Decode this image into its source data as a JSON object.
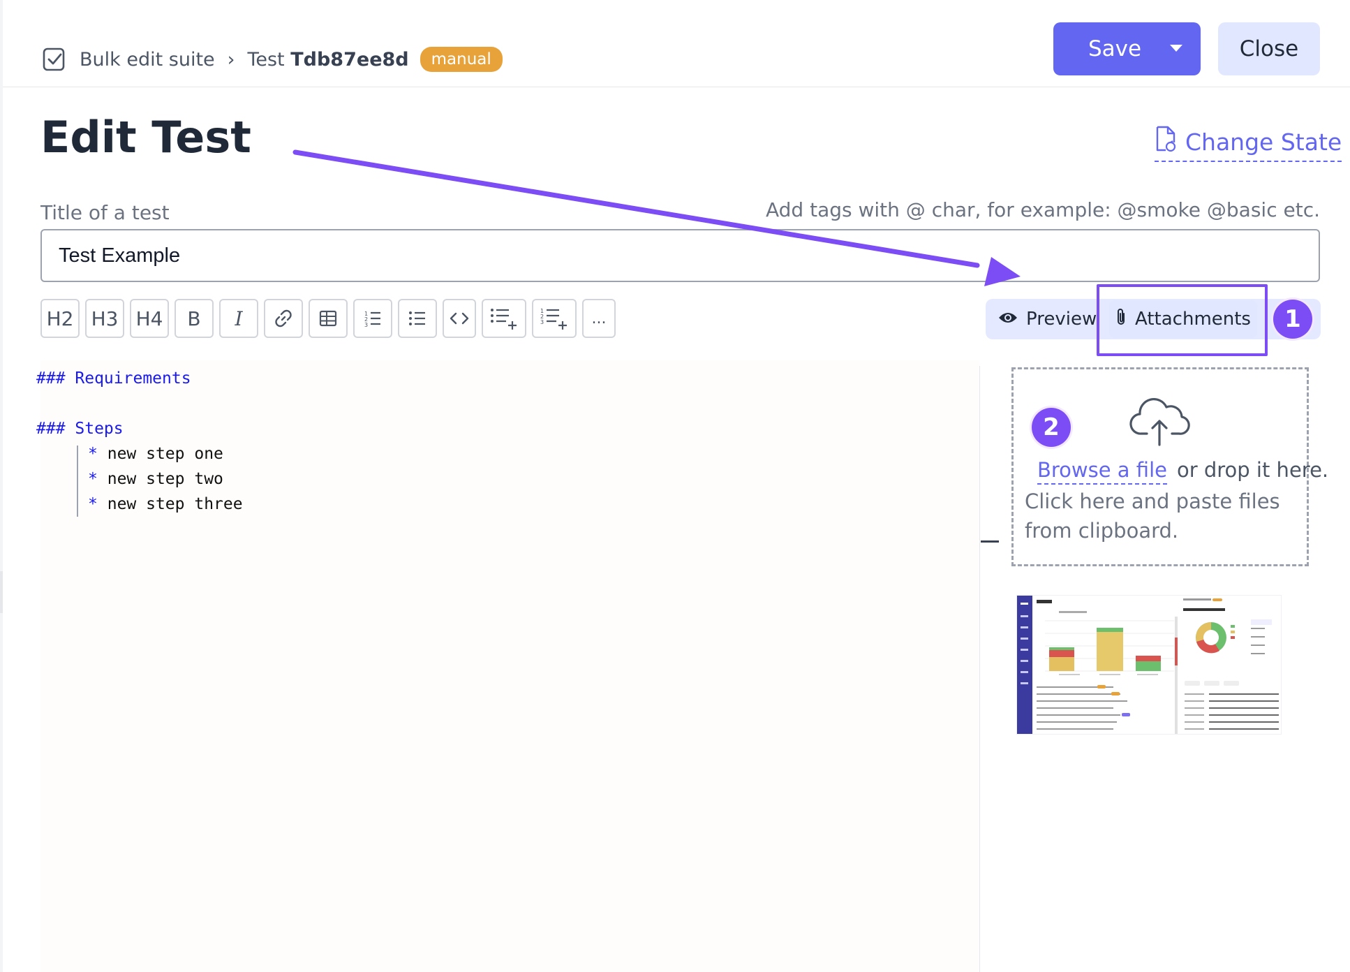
{
  "breadcrumb": {
    "suite": "Bulk edit suite",
    "separator": "›",
    "test_prefix": "Test",
    "test_id": "Tdb87ee8d",
    "badge": "manual"
  },
  "header": {
    "save_label": "Save",
    "close_label": "Close"
  },
  "page": {
    "title": "Edit Test",
    "change_state": "Change State"
  },
  "form": {
    "title_label": "Title of a test",
    "tags_hint": "Add tags with @ char, for example: @smoke @basic etc.",
    "title_value": "Test Example"
  },
  "toolbar": {
    "items": [
      {
        "name": "heading-2-button",
        "label": "H2"
      },
      {
        "name": "heading-3-button",
        "label": "H3"
      },
      {
        "name": "heading-4-button",
        "label": "H4"
      },
      {
        "name": "bold-button",
        "label": "B"
      },
      {
        "name": "italic-button",
        "label": "I"
      },
      {
        "name": "link-button",
        "icon": "link-icon"
      },
      {
        "name": "table-button",
        "icon": "table-icon"
      },
      {
        "name": "ordered-list-button",
        "icon": "ordered-list-icon"
      },
      {
        "name": "bullet-list-button",
        "icon": "bullet-list-icon"
      },
      {
        "name": "code-button",
        "icon": "code-icon"
      },
      {
        "name": "insert-bullet-step-button",
        "icon": "list-add-icon"
      },
      {
        "name": "insert-numbered-step-button",
        "icon": "numbered-list-add-icon"
      },
      {
        "name": "more-button",
        "label": "..."
      }
    ],
    "preview_label": "Preview",
    "attachments_label": "Attachments"
  },
  "annotations": {
    "marker_1": "1",
    "marker_2": "2",
    "accent_color": "#7c4df5"
  },
  "editor": {
    "lines": [
      {
        "type": "heading",
        "text": "### Requirements"
      },
      {
        "type": "blank",
        "text": ""
      },
      {
        "type": "heading",
        "text": "### Steps"
      },
      {
        "type": "bullet",
        "star": "*",
        "text": "new step one"
      },
      {
        "type": "bullet",
        "star": "*",
        "text": "new step two"
      },
      {
        "type": "bullet",
        "star": "*",
        "text": "new step three"
      }
    ]
  },
  "attachments": {
    "browse_link": "Browse a file",
    "drop_text": "or drop it here.",
    "paste_text": "Click here and paste files from clipboard.",
    "thumbnail_icon": "runs-screenshot-thumbnail"
  },
  "colors": {
    "primary": "#6366f1",
    "primary_light": "#e0e7ff",
    "badge": "#e8a23a",
    "markdown_heading": "#1a1aee"
  }
}
